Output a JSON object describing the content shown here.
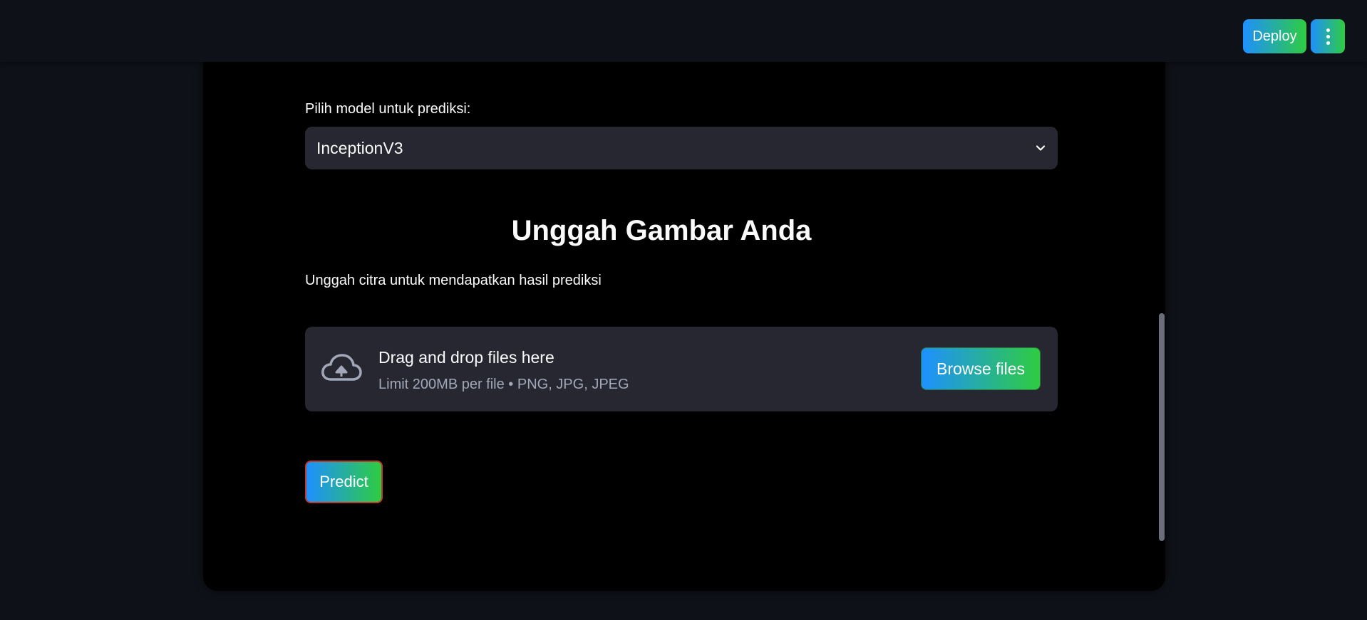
{
  "header": {
    "deploy_label": "Deploy",
    "menu_icon": "kebab-menu-icon"
  },
  "model_select": {
    "label": "Pilih model untuk prediksi:",
    "value": "InceptionV3",
    "icon": "chevron-down-icon"
  },
  "upload_section": {
    "heading": "Unggah Gambar Anda",
    "subtext": "Unggah citra untuk mendapatkan hasil prediksi",
    "dropzone": {
      "icon": "cloud-upload-icon",
      "title": "Drag and drop files here",
      "limit": "Limit 200MB per file • PNG, JPG, JPEG",
      "browse_label": "Browse files"
    }
  },
  "predict_label": "Predict",
  "colors": {
    "background": "#0e1117",
    "card": "#000000",
    "input_bg": "#262730",
    "gradient_start": "#1e90ff",
    "gradient_end": "#2ecc40",
    "predict_border": "#c0392b"
  }
}
